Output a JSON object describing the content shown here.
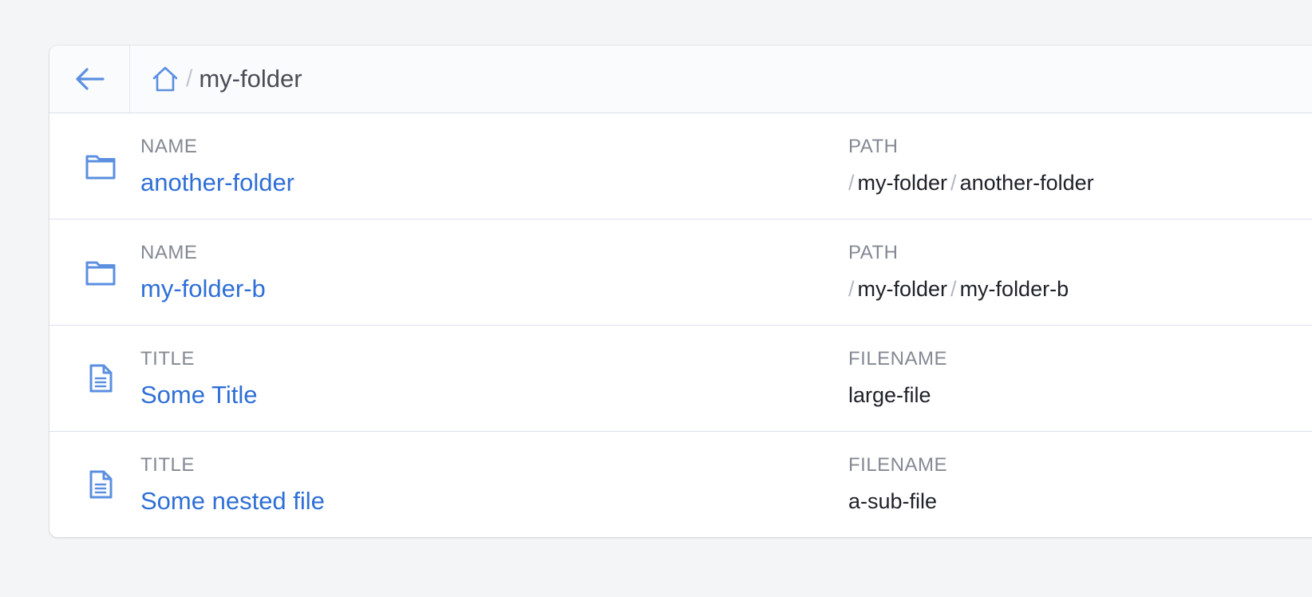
{
  "breadcrumb": {
    "current": "my-folder",
    "separator": "/"
  },
  "columns": {
    "name": "NAME",
    "path": "PATH",
    "title": "TITLE",
    "filename": "FILENAME"
  },
  "rows": [
    {
      "type": "folder",
      "icon": "folder-icon",
      "label_a": "NAME",
      "value_a": "another-folder",
      "label_b": "PATH",
      "path": [
        "my-folder",
        "another-folder"
      ]
    },
    {
      "type": "folder",
      "icon": "folder-icon",
      "label_a": "NAME",
      "value_a": "my-folder-b",
      "label_b": "PATH",
      "path": [
        "my-folder",
        "my-folder-b"
      ]
    },
    {
      "type": "file",
      "icon": "document-icon",
      "label_a": "TITLE",
      "value_a": "Some Title",
      "label_b": "FILENAME",
      "value_b": "large-file"
    },
    {
      "type": "file",
      "icon": "document-icon",
      "label_a": "TITLE",
      "value_a": "Some nested file",
      "label_b": "FILENAME",
      "value_b": "a-sub-file"
    }
  ],
  "colors": {
    "accent": "#2f6fd6",
    "icon": "#5b8fe0",
    "muted": "#848893"
  }
}
